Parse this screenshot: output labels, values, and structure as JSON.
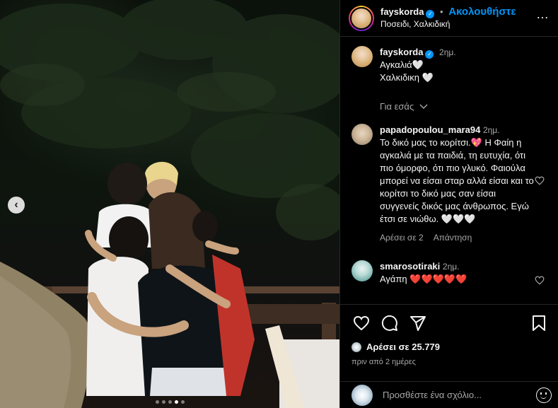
{
  "post": {
    "username": "fayskorda",
    "follow_label": "Ακολουθήστε",
    "separator": "•",
    "location": "Ποσειδι, Χαλκιδική",
    "more_label": "…"
  },
  "caption": {
    "username": "fayskorda",
    "time": "2ημ.",
    "line1": "Αγκαλιά🤍",
    "line2": "Χαλκιδικη 🤍",
    "translation_toggle": "Για εσάς"
  },
  "comments": [
    {
      "username": "papadopoulou_mara94",
      "time": "2ημ.",
      "text": "Το δικό μας το κορίτσι.💖 Η Φαίη η αγκαλιά με τα παιδιά, τη ευτυχία, ότι πιο όμορφο, ότι πιο γλυκό. Φαιούλα μπορεί να είσαι σταρ αλλά είσαι και το κορίτσι το δικό μας σαν είσαι συγγενείς δικός μας άνθρωπος. Εγώ έτσι σε νιώθω. 🤍🤍🤍",
      "likes": "Αρέσει σε 2",
      "reply": "Απάντηση"
    },
    {
      "username": "smarosotiraki",
      "time": "2ημ.",
      "text": "Αγάπη ❤️❤️❤️❤️❤️"
    }
  ],
  "actions": {
    "likes_text": "Αρέσει σε 25.779",
    "posted_ago": "πριν από 2 ημέρες"
  },
  "composer": {
    "placeholder": "Προσθέστε ένα σχόλιο..."
  },
  "carousel": {
    "total": 5,
    "active": 4,
    "prev_label": "‹"
  },
  "colors": {
    "accent": "#0095f6",
    "background": "#000000",
    "divider": "#262626",
    "muted_text": "#a8a8a8"
  }
}
